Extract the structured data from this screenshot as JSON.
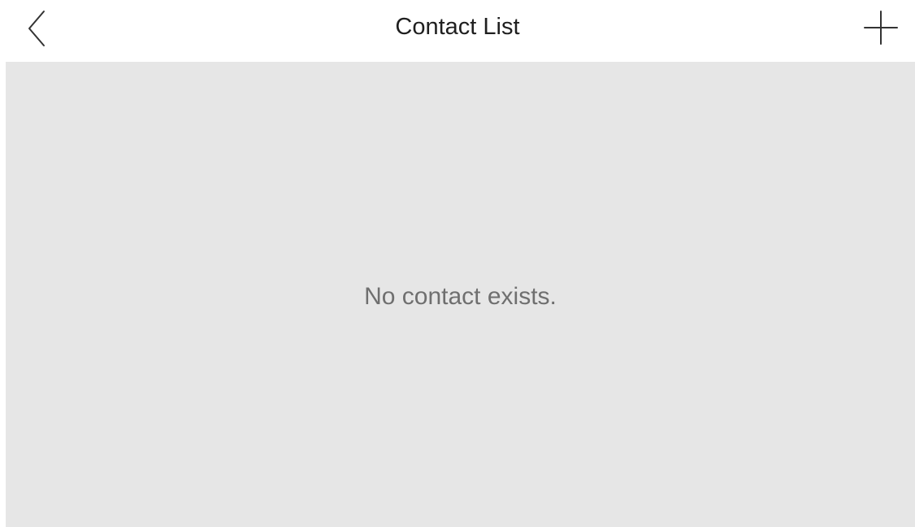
{
  "header": {
    "title": "Contact List",
    "back_icon": "chevron-left-icon",
    "add_icon": "plus-icon"
  },
  "content": {
    "empty_message": "No contact exists."
  },
  "colors": {
    "header_bg": "#ffffff",
    "content_bg": "#e6e6e6",
    "title_text": "#1f1f1f",
    "message_text": "#6f6f6f",
    "icon_stroke": "#333333"
  }
}
